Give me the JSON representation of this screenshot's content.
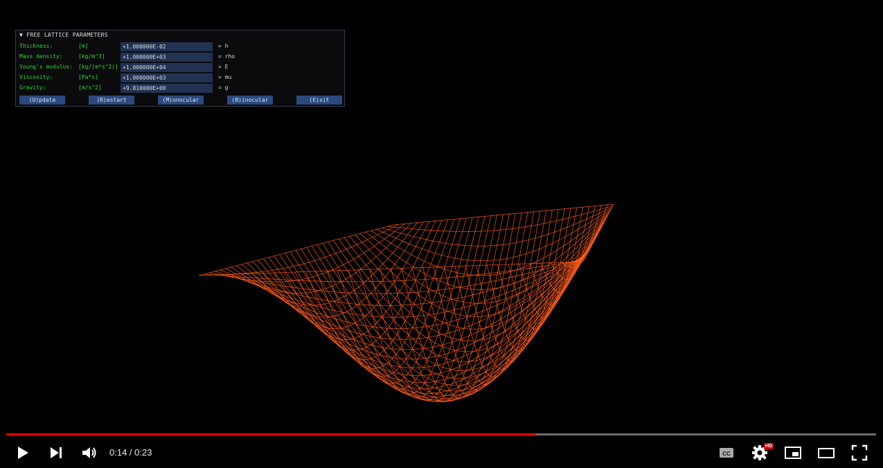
{
  "panel": {
    "title": "▼ FREE LATTICE PARAMETERS",
    "rows": [
      {
        "label": "Thickness:",
        "unit": "[m]",
        "value": "+1.000000E-02",
        "symbol": "= h"
      },
      {
        "label": "Mass density:",
        "unit": "[kg/m^3]",
        "value": "+1.000000E+03",
        "symbol": "= rho"
      },
      {
        "label": "Young's modulus:",
        "unit": "[kg/(m*s^2)]",
        "value": "+1.000000E+04",
        "symbol": "= E"
      },
      {
        "label": "Viscosity:",
        "unit": "[Pa*s]",
        "value": "+1.000000E+03",
        "symbol": "= mu"
      },
      {
        "label": "Gravity:",
        "unit": "[m/s^2]",
        "value": "+9.810000E+00",
        "symbol": "= g"
      }
    ],
    "buttons": [
      "(U)pdate",
      "(R)estart",
      "(M)onocular",
      "(B)inocular",
      "(E)xit"
    ]
  },
  "player": {
    "time": "0:14 / 0:23",
    "progress": 0.6085,
    "hd_badge": "HD",
    "icons": [
      "play-icon",
      "next-icon",
      "volume-icon",
      "captions-icon",
      "settings-icon",
      "miniplayer-icon",
      "theater-icon",
      "fullscreen-icon"
    ]
  },
  "colors": {
    "accent": "#ff0000",
    "label_green": "#2fd62f",
    "field_bg": "#223252",
    "button_bg": "#2a4a7e",
    "mesh": "#ff5a1a"
  }
}
